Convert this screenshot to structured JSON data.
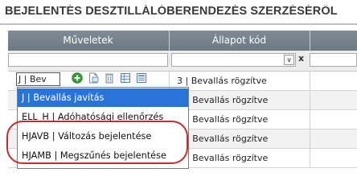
{
  "page": {
    "title": "BEJELENTÉS DESZTILLÁLÓBERENDEZÉS SZERZÉSÉRŐL"
  },
  "grid": {
    "columns": [
      "Műveletek",
      "Állapot kód"
    ],
    "filter": {
      "clear_label": "x"
    },
    "row_edit_select_value": "J | Bev",
    "rows": [
      {
        "status": "3 | Bevallás rögzítve"
      },
      {
        "status": "| Bevallás rögzítve"
      },
      {
        "status": "| Bevallás rögzítve"
      },
      {
        "status": "| Bevallás rögzítve"
      },
      {
        "status": "| Bevallás rögzítve"
      }
    ]
  },
  "dropdown": {
    "options": [
      {
        "label": "J | Bevallás javítás",
        "selected": true
      },
      {
        "label": "ELL_H | Adóhatósági ellenőrzés",
        "selected": false
      },
      {
        "label": "HJAVB | Változás bejelentése",
        "selected": false
      },
      {
        "label": "HJAMB | Megszűnés bejelentése",
        "selected": false
      }
    ]
  },
  "icons": [
    "add-icon",
    "document-icon",
    "delete-icon",
    "table-icon",
    "report-icon"
  ],
  "colors": {
    "header_bg": "#737f88",
    "selected_bg": "#2874d8",
    "highlight": "#c72a2a"
  }
}
